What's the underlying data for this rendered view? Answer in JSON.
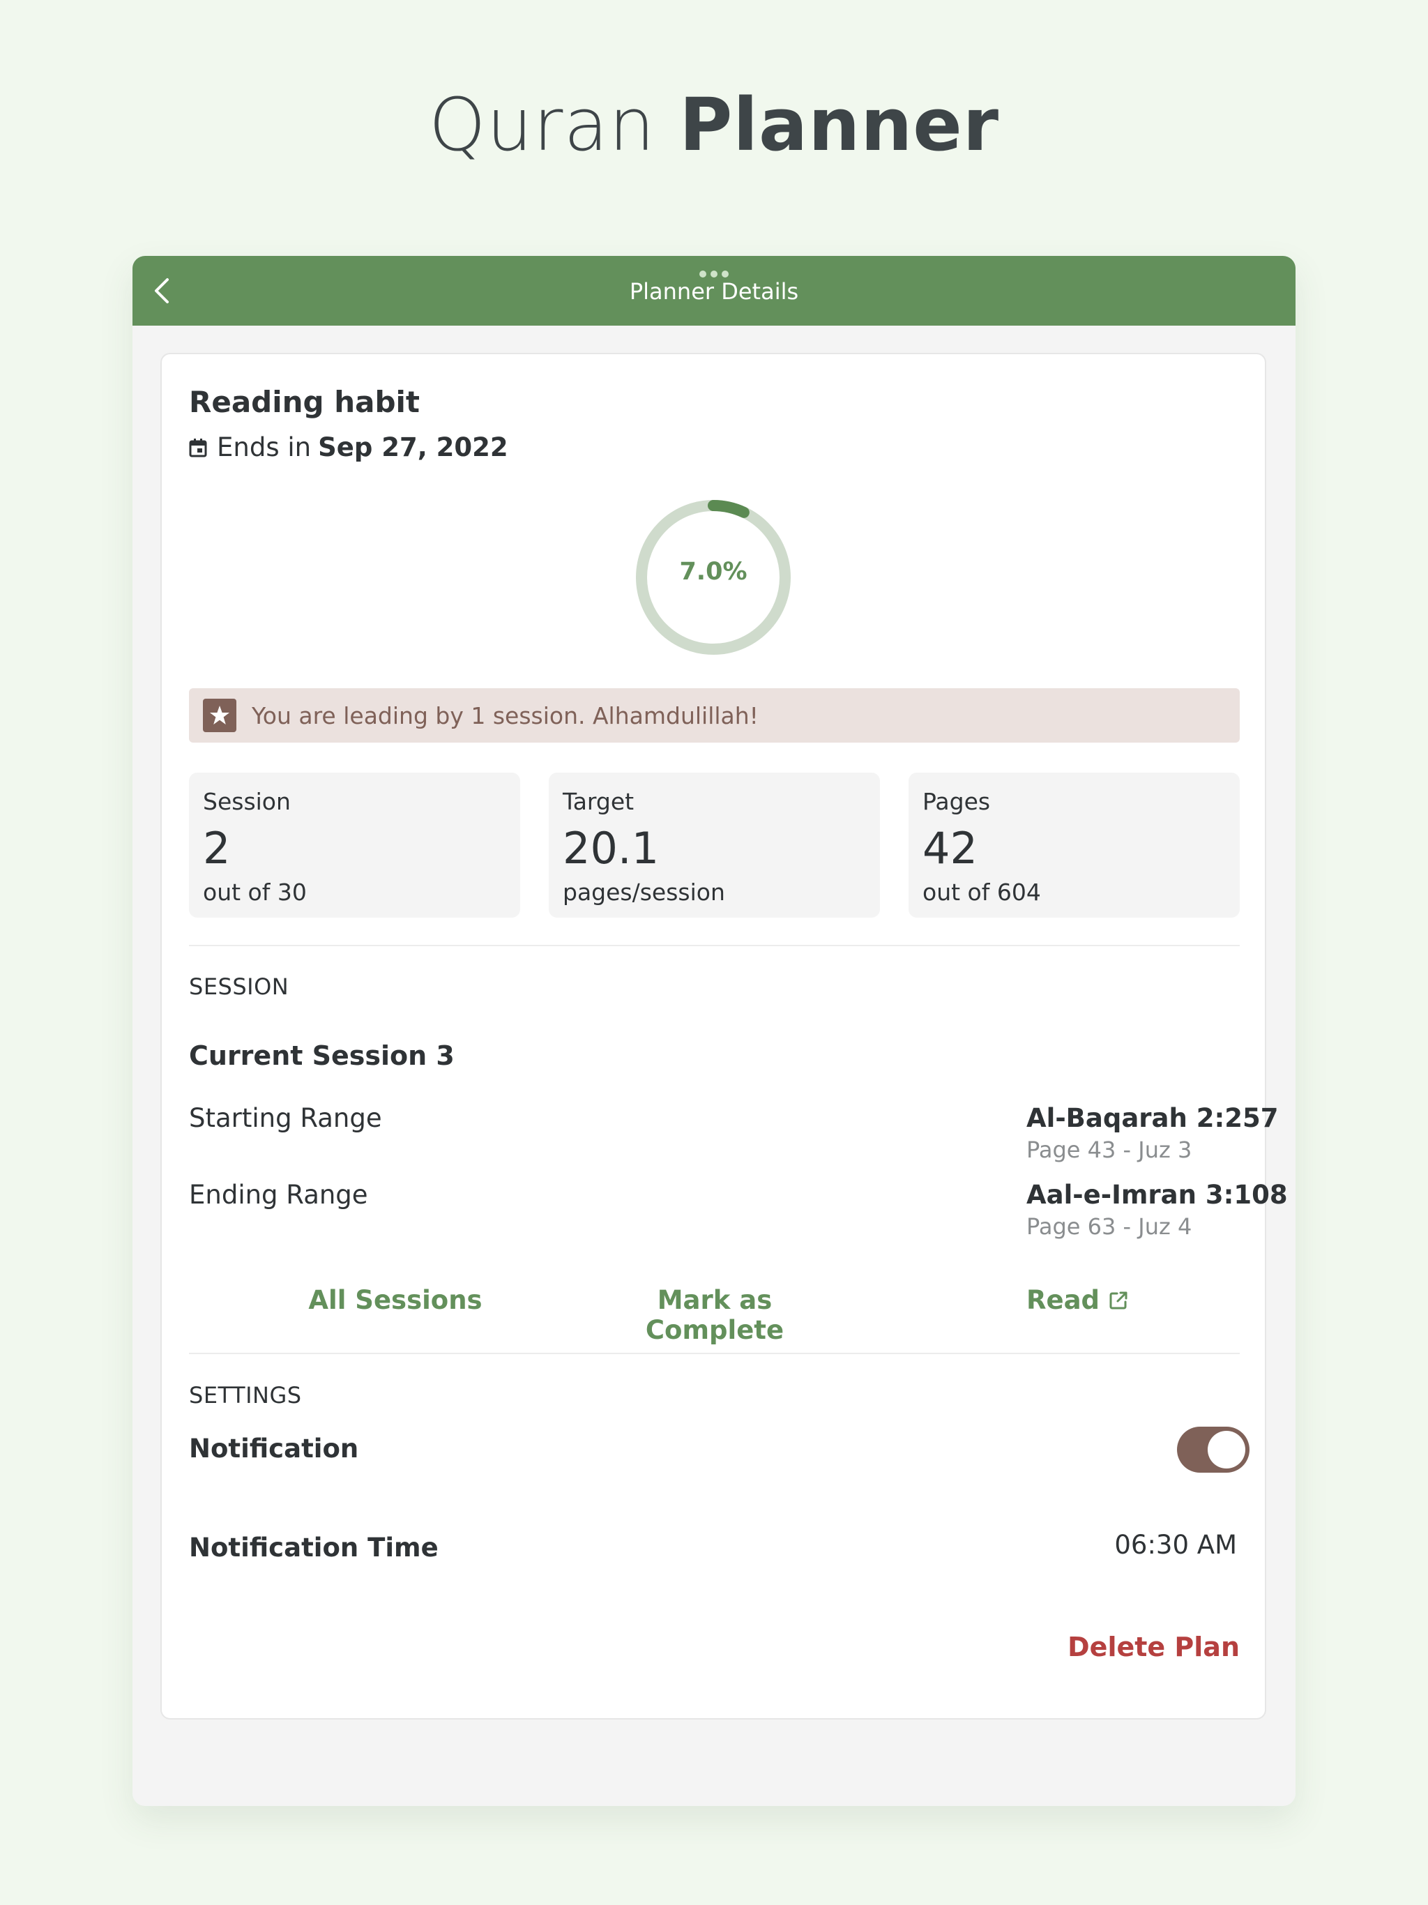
{
  "headline": {
    "light": "Quran ",
    "bold": "Planner"
  },
  "appbar": {
    "title": "Planner Details"
  },
  "plan": {
    "title": "Reading habit",
    "ends_prefix": "Ends in",
    "ends_date": "Sep 27, 2022",
    "progress_label": "7.0%",
    "progress_fraction": 0.07
  },
  "banner": {
    "text": "You are leading by 1 session. Alhamdulillah!"
  },
  "stats": [
    {
      "label": "Session",
      "value": "2",
      "sub": "out of 30"
    },
    {
      "label": "Target",
      "value": "20.1",
      "sub": "pages/session"
    },
    {
      "label": "Pages",
      "value": "42",
      "sub": "out of 604"
    }
  ],
  "session": {
    "caption": "SESSION",
    "current": "Current Session 3",
    "starting_label": "Starting Range",
    "starting_value": "Al-Baqarah 2:257",
    "starting_sub": "Page 43 - Juz 3",
    "ending_label": "Ending Range",
    "ending_value": "Aal-e-Imran 3:108",
    "ending_sub": "Page 63 - Juz 4"
  },
  "actions": {
    "all_sessions": "All Sessions",
    "mark_complete": "Mark as Complete",
    "read": "Read"
  },
  "settings": {
    "caption": "SETTINGS",
    "notification_label": "Notification",
    "notification_enabled": true,
    "time_label": "Notification Time",
    "time_value": "06:30 AM"
  },
  "delete_label": "Delete Plan",
  "colors": {
    "primary_green": "#63905b",
    "brown_accent": "#7f6158",
    "danger_red": "#b5403f",
    "background": "#f1f8ee"
  }
}
